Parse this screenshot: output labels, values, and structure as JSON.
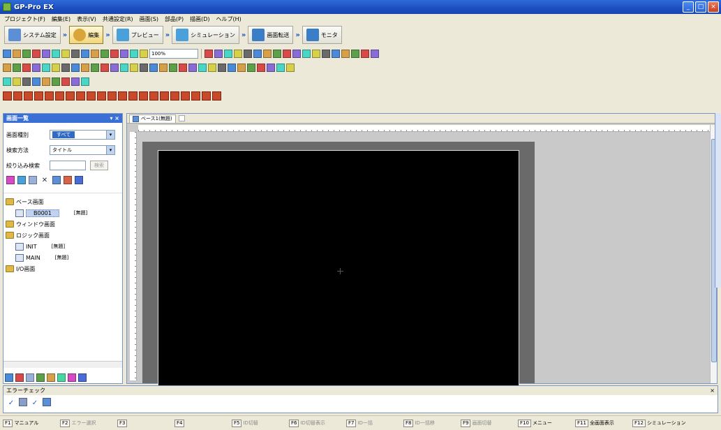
{
  "window": {
    "title": "GP-Pro EX",
    "buttons": [
      "_",
      "□",
      "×"
    ]
  },
  "menu": {
    "items": [
      "プロジェクト(F)",
      "編集(E)",
      "表示(V)",
      "共通設定(R)",
      "画面(S)",
      "部品(P)",
      "描画(D)",
      "ヘルプ(H)"
    ]
  },
  "workflow": {
    "steps": [
      {
        "label": "システム設定",
        "color": "#5c8fd6"
      },
      {
        "label": "編集",
        "color": "#d9a43a",
        "active": true
      },
      {
        "label": "プレビュー",
        "color": "#4aa0d8"
      },
      {
        "label": "シミュレーション",
        "color": "#4aa0d8"
      },
      {
        "label": "画面転送",
        "color": "#3a7ec8"
      },
      {
        "label": "モニタ",
        "color": "#3a7ec8"
      }
    ]
  },
  "toolbar": {
    "zoom_value": "100%",
    "row1_icons": [
      "new-icon",
      "open-icon",
      "save-icon",
      "copy-icon",
      "paste-icon",
      "screen-icon",
      "layer-icon",
      "cut-icon",
      "copy2-icon",
      "undo-icon",
      "redo-icon",
      "grid-icon",
      "snap-icon",
      "delete-icon",
      "filter-icon"
    ],
    "row1_icons2": [
      "zoom-icon",
      "lamp-icon",
      "data-icon",
      "switch-icon",
      "pen-icon",
      "link-icon",
      "alarm-icon",
      "clock-icon",
      "graph-icon",
      "meter-icon",
      "key-icon",
      "bolt-icon",
      "person-icon",
      "tag-icon",
      "window-icon",
      "chart-icon",
      "tool-icon",
      "wrench-icon"
    ],
    "row2_icons": [
      "pointer-icon",
      "text-icon",
      "dot-icon",
      "line-icon",
      "polyline-icon",
      "rect-icon",
      "circle-icon",
      "ellipse-icon",
      "arc-icon",
      "pen-icon",
      "draw-icon",
      "table-icon",
      "scale-icon",
      "fill-icon",
      "lamp-icon",
      "switch-icon",
      "bar-icon",
      "display-icon",
      "numeric-icon",
      "keypad-icon",
      "cross-icon",
      "alarm-icon",
      "picture-icon",
      "trend-icon",
      "data-icon",
      "history-icon",
      "recipe-icon",
      "print-icon",
      "window-icon",
      "parts-icon"
    ],
    "row3_icons": [
      "align-left-icon",
      "align-top-icon",
      "align-center-icon",
      "space-icon",
      "group-icon",
      "rotate-icon",
      "flip-icon",
      "front-icon",
      "back-icon"
    ],
    "row4_colors": [
      "#c84a2a",
      "#c84a2a",
      "#c84a2a",
      "#c84a2a",
      "#c84a2a",
      "#c84a2a",
      "#c84a2a",
      "#c84a2a",
      "#c84a2a",
      "#c84a2a",
      "#c84a2a",
      "#c84a2a",
      "#c84a2a",
      "#c84a2a",
      "#c84a2a",
      "#c84a2a",
      "#c84a2a",
      "#c84a2a",
      "#c84a2a",
      "#c84a2a",
      "#c84a2a"
    ]
  },
  "left_panel": {
    "title": "画面一覧",
    "fields": [
      {
        "label": "画面種別",
        "value": "すべて"
      },
      {
        "label": "検索方法",
        "value": "タイトル"
      }
    ],
    "filter_label": "絞り込み検索",
    "filter_button": "検索",
    "tree": {
      "base_group": "ベース画面",
      "base_items": [
        {
          "id": "B0001",
          "tag": "[無題]"
        }
      ],
      "window_group": "ウィンドウ画面",
      "logic_group": "ロジック画面",
      "logic_items": [
        {
          "id": "INIT",
          "tag": "[無題]"
        },
        {
          "id": "MAIN",
          "tag": "[無題]"
        }
      ],
      "io_group": "I/O画面"
    }
  },
  "editor": {
    "tab_label": "ベース1(無題)",
    "canvas_color": "#000000"
  },
  "error_panel": {
    "title": "エラーチェック",
    "close": "×"
  },
  "fkeys": [
    {
      "key": "F1",
      "label": "マニュアル",
      "on": true
    },
    {
      "key": "F2",
      "label": "エラー選択",
      "on": false
    },
    {
      "key": "F3",
      "label": "",
      "on": false
    },
    {
      "key": "F4",
      "label": "",
      "on": false
    },
    {
      "key": "F5",
      "label": "ID切替",
      "on": false
    },
    {
      "key": "F6",
      "label": "ID切替表示",
      "on": false
    },
    {
      "key": "F7",
      "label": "ID一括",
      "on": false
    },
    {
      "key": "F8",
      "label": "ID一括移",
      "on": false
    },
    {
      "key": "F9",
      "label": "画面切替",
      "on": false
    },
    {
      "key": "F10",
      "label": "メニュー",
      "on": true
    },
    {
      "key": "F11",
      "label": "全画面表示",
      "on": true
    },
    {
      "key": "F12",
      "label": "シミュレーション",
      "on": true
    }
  ]
}
